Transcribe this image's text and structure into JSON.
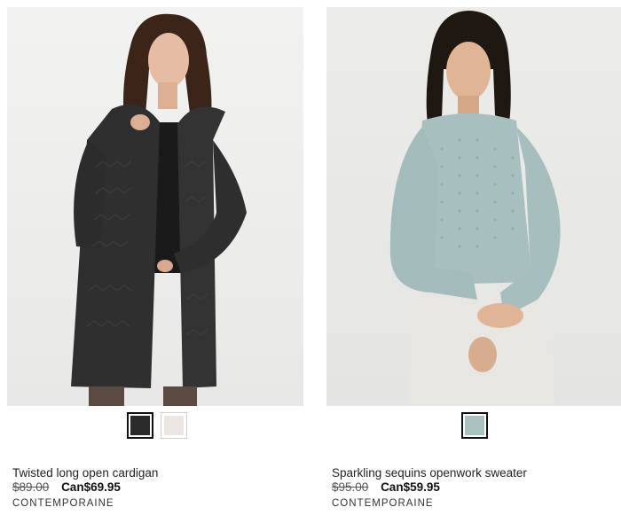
{
  "products": [
    {
      "title": "Twisted long open cardigan",
      "old_price": "$89.00",
      "new_price": "Can$69.95",
      "brand": "CONTEMPORAINE",
      "swatches": [
        {
          "color": "#2b2b2b",
          "selected": true
        },
        {
          "color": "#ece6e3",
          "selected": false
        }
      ]
    },
    {
      "title": "Sparkling sequins openwork sweater",
      "old_price": "$95.00",
      "new_price": "Can$59.95",
      "brand": "CONTEMPORAINE",
      "swatches": [
        {
          "color": "#a8c2c2",
          "selected": true
        }
      ]
    }
  ]
}
